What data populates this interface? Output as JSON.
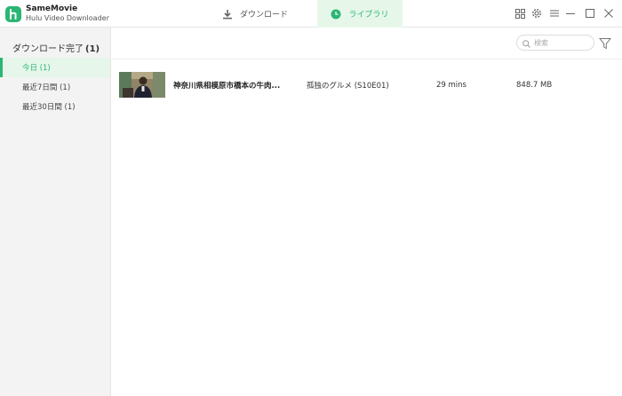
{
  "app": {
    "name": "SameMovie",
    "subtitle": "Hulu Video Downloader"
  },
  "tabs": {
    "download": "ダウンロード",
    "library": "ライブラリ"
  },
  "sidebar": {
    "header_label": "ダウンロード完了",
    "header_count": "(1)",
    "items": [
      {
        "label": "今日 (1)",
        "active": true
      },
      {
        "label": "最近7日間 (1)",
        "active": false
      },
      {
        "label": "最近30日間 (1)",
        "active": false
      }
    ]
  },
  "search": {
    "placeholder": "検索"
  },
  "rows": [
    {
      "title": "神奈川県相模原市橋本の牛肉...",
      "episode": "孤独のグルメ (S10E01)",
      "duration": "29 mins",
      "size": "848.7 MB"
    }
  ],
  "colors": {
    "accent": "#2bb673",
    "active_bg": "#e6f6ea",
    "sidebar_bg": "#f3f3f3"
  },
  "icons": {
    "logo": "app-logo",
    "download_tab": "download-icon",
    "library_tab": "clock-icon",
    "grid": "grid-icon",
    "settings": "gear-icon",
    "menu": "menu-icon",
    "minimize": "minimize-icon",
    "maximize": "maximize-icon",
    "close": "close-icon",
    "search": "search-icon",
    "filter": "filter-icon"
  }
}
